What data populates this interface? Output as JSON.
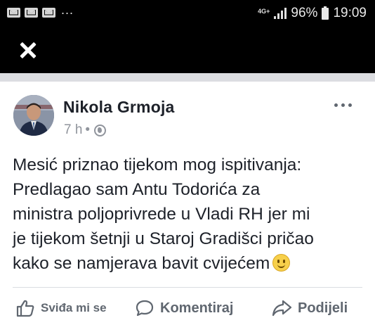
{
  "status_bar": {
    "notification_icons": [
      "mail-icon",
      "mail-icon",
      "mail-icon"
    ],
    "more_notifications": "...",
    "network": "4G+",
    "battery": "96%",
    "time": "19:09"
  },
  "viewer": {
    "close_icon": "close-icon"
  },
  "post": {
    "author": "Nikola Grmoja",
    "time": "7 h",
    "separator": "•",
    "privacy_icon": "globe-icon",
    "text_lines": [
      "Mesić priznao tijekom mog ispitivanja:",
      "Predlagao sam Antu Todorića za",
      "ministra poljoprivrede u Vladi RH jer mi",
      "je tijekom šetnji u Staroj Gradišci pričao",
      "kako se namjerava bavit cvijećem"
    ],
    "emoji": "smiley-icon"
  },
  "actions": {
    "like": "Sviđa mi se",
    "comment": "Komentiraj",
    "share": "Podijeli"
  },
  "colors": {
    "header_bg": "#000000",
    "text": "#1d2129",
    "secondary_text": "#606770",
    "meta_text": "#90949c"
  }
}
